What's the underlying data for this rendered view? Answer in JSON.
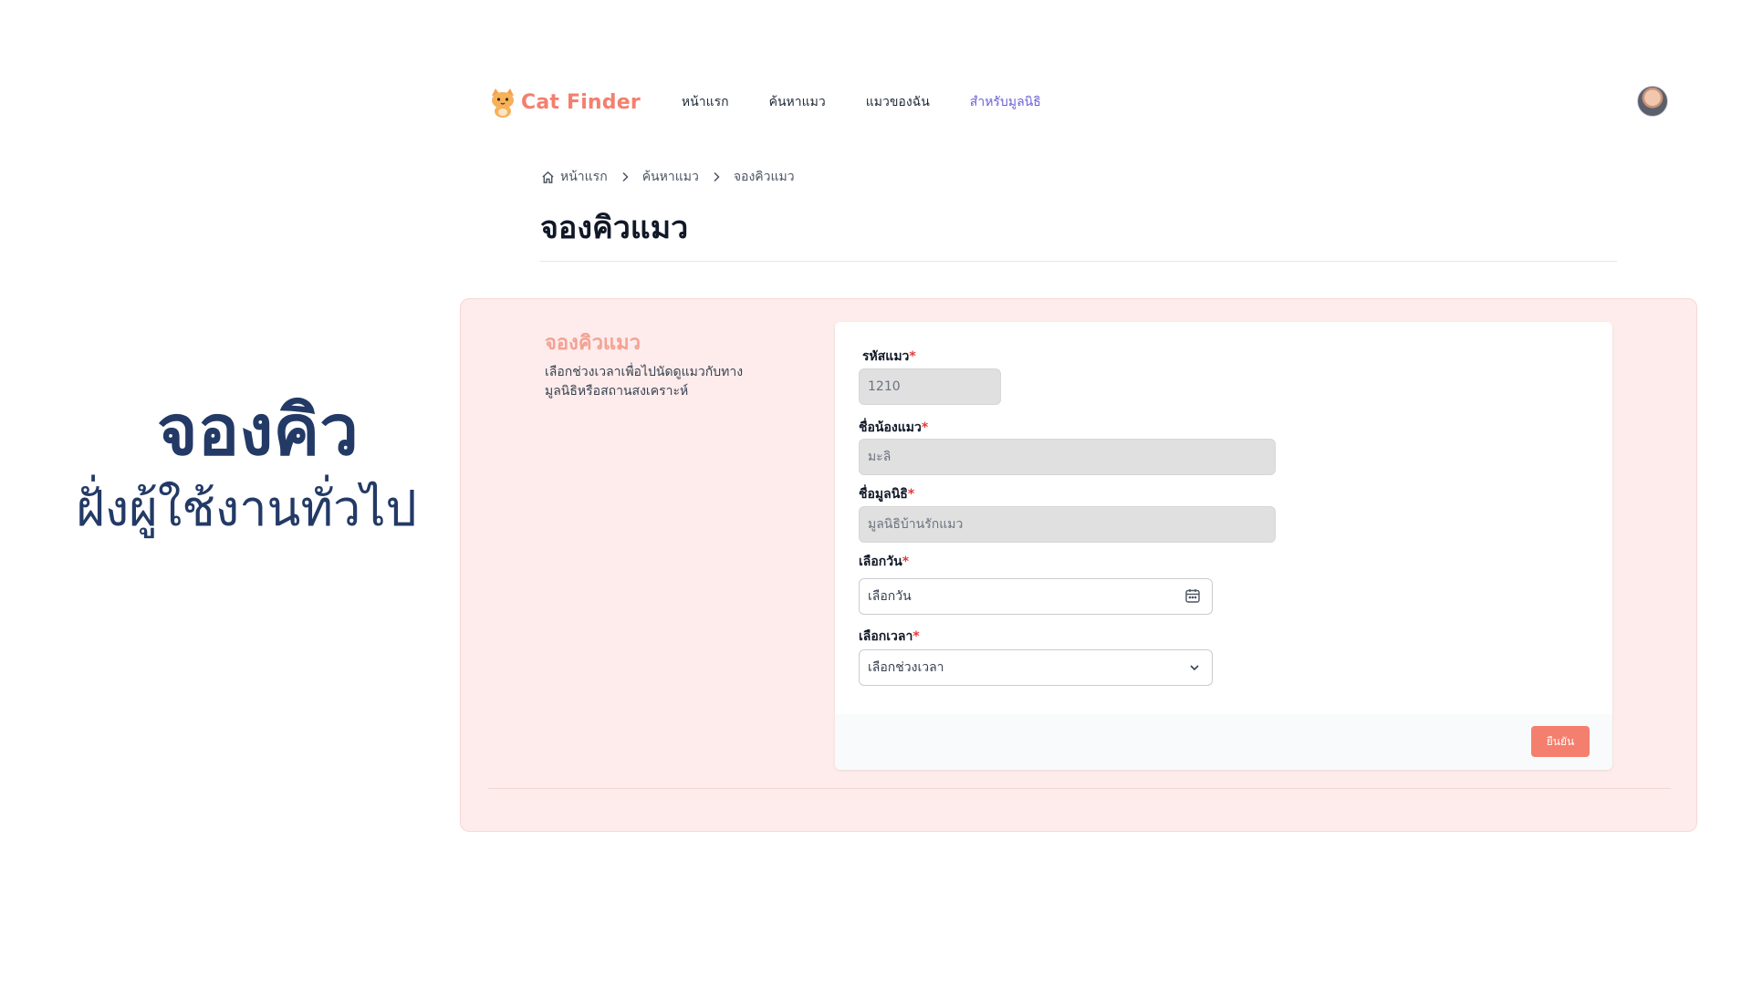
{
  "caption": {
    "title": "จองคิว",
    "subtitle": "ฝั่งผู้ใช้งานทั่วไป"
  },
  "brand": {
    "name": "Cat Finder",
    "logo_icon": "cat-icon",
    "color": "#f47f6e"
  },
  "nav": {
    "items": [
      {
        "label": "หน้าแรก",
        "active": false
      },
      {
        "label": "ค้นหาแมว",
        "active": false
      },
      {
        "label": "แมวของฉัน",
        "active": false
      },
      {
        "label": "สำหรับมูลนิธิ",
        "active": true
      }
    ],
    "active_color": "#6b62d6"
  },
  "breadcrumb": {
    "home_icon": "home-icon",
    "items": [
      "หน้าแรก",
      "ค้นหาแมว",
      "จองคิวแมว"
    ],
    "separator_icon": "chevron-right-icon"
  },
  "page": {
    "title": "จองคิวแมว"
  },
  "section": {
    "title": "จองคิวแมว",
    "description": "เลือกช่วงเวลาเพื่อไปนัดดูแมวกับทางมูลนิธิหรือสถานสงเคราะห์"
  },
  "form": {
    "cat_id": {
      "label": "รหัสแมว",
      "required_mark": "*",
      "value": "1210"
    },
    "cat_name": {
      "label": "ชื่อน้องแมว",
      "required_mark": "*",
      "value": "มะลิ"
    },
    "foundation": {
      "label": "ชื่อมูลนิธิ",
      "required_mark": "*",
      "value": "มูลนิธิบ้านรักแมว"
    },
    "date": {
      "label": "เลือกวัน",
      "required_mark": "*",
      "placeholder": "เลือกวัน",
      "icon": "calendar-icon"
    },
    "time": {
      "label": "เลือกเวลา",
      "required_mark": "*",
      "selected": "เลือกช่วงเวลา",
      "icon": "chevron-down-icon"
    },
    "submit_label": "ยืนยัน"
  },
  "colors": {
    "panel_bg": "#fdeceb",
    "accent": "#f47f6e",
    "caption": "#233a66"
  }
}
